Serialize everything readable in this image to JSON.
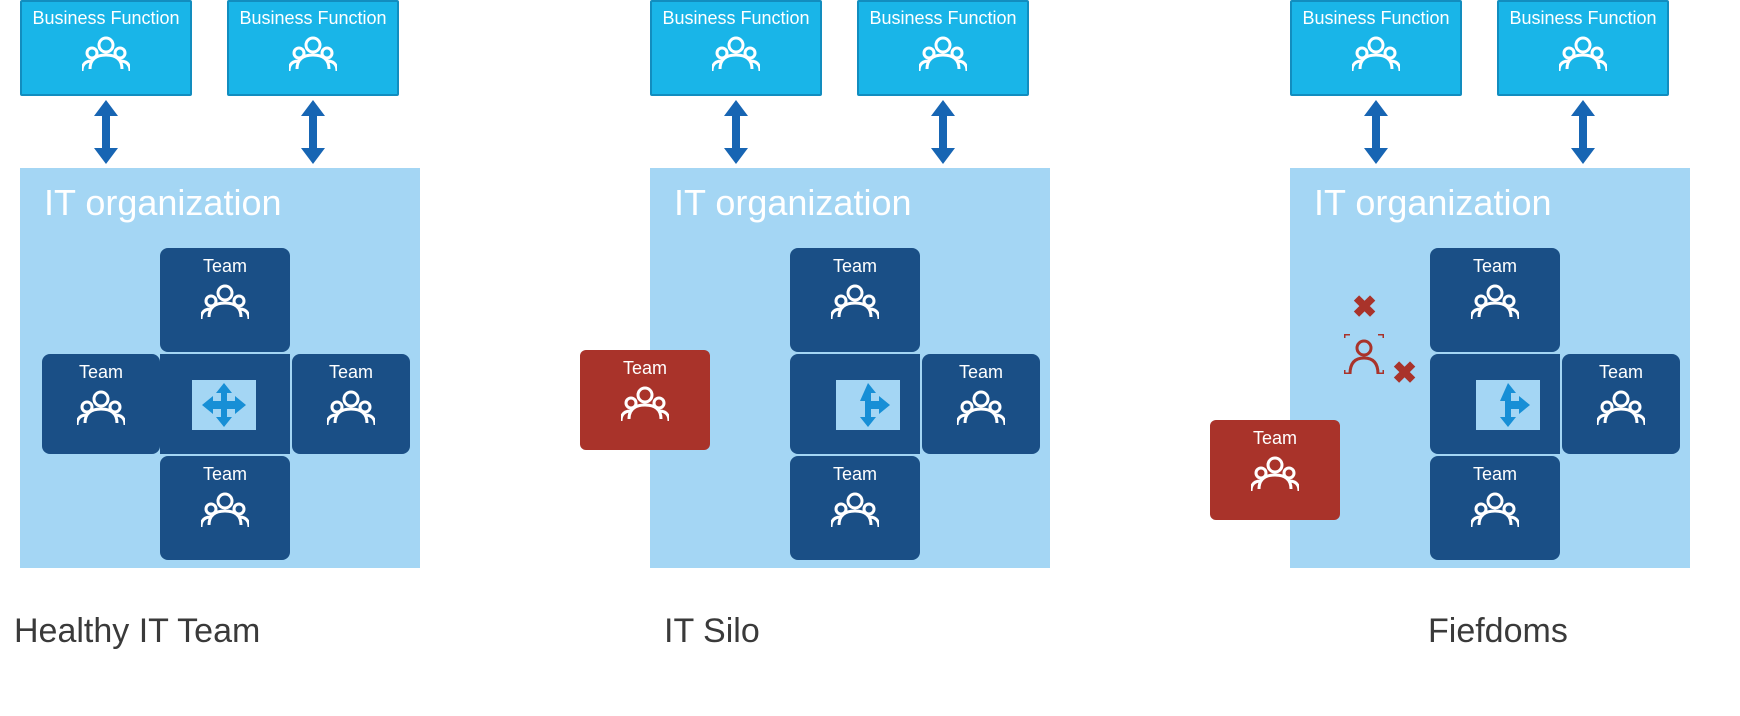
{
  "colors": {
    "business_function_bg": "#19b5e8",
    "business_function_border": "#128dbf",
    "it_org_bg": "#a4d6f4",
    "team_bg": "#1a4f86",
    "danger_bg": "#a9332a",
    "arrow": "#1765b3",
    "caption": "#3a3a3a"
  },
  "labels": {
    "business_function": "Business Function",
    "it_org_title": "IT organization",
    "team": "Team"
  },
  "panels": [
    {
      "id": "healthy",
      "caption": "Healthy IT Team",
      "business_functions": 2,
      "it_org": {
        "title": "IT organization",
        "teams": [
          {
            "position": "top",
            "label": "Team",
            "status": "normal"
          },
          {
            "position": "left",
            "label": "Team",
            "status": "normal"
          },
          {
            "position": "right",
            "label": "Team",
            "status": "normal"
          },
          {
            "position": "bottom",
            "label": "Team",
            "status": "normal"
          }
        ],
        "center_icon": "four-way-arrows",
        "detached_left_team": false,
        "isolated_person_with_x": false
      }
    },
    {
      "id": "silo",
      "caption": "IT Silo",
      "business_functions": 2,
      "it_org": {
        "title": "IT organization",
        "teams": [
          {
            "position": "top",
            "label": "Team",
            "status": "normal"
          },
          {
            "position": "right",
            "label": "Team",
            "status": "normal"
          },
          {
            "position": "bottom",
            "label": "Team",
            "status": "normal"
          }
        ],
        "center_icon": "three-way-arrows",
        "detached_left_team": {
          "label": "Team",
          "status": "danger"
        },
        "isolated_person_with_x": false
      }
    },
    {
      "id": "fiefdoms",
      "caption": "Fiefdoms",
      "business_functions": 2,
      "it_org": {
        "title": "IT organization",
        "teams": [
          {
            "position": "top",
            "label": "Team",
            "status": "normal"
          },
          {
            "position": "right",
            "label": "Team",
            "status": "normal"
          },
          {
            "position": "bottom",
            "label": "Team",
            "status": "normal"
          }
        ],
        "center_icon": "three-way-arrows",
        "detached_left_team": {
          "label": "Team",
          "status": "danger",
          "offset": "low"
        },
        "isolated_person_with_x": true
      }
    }
  ]
}
